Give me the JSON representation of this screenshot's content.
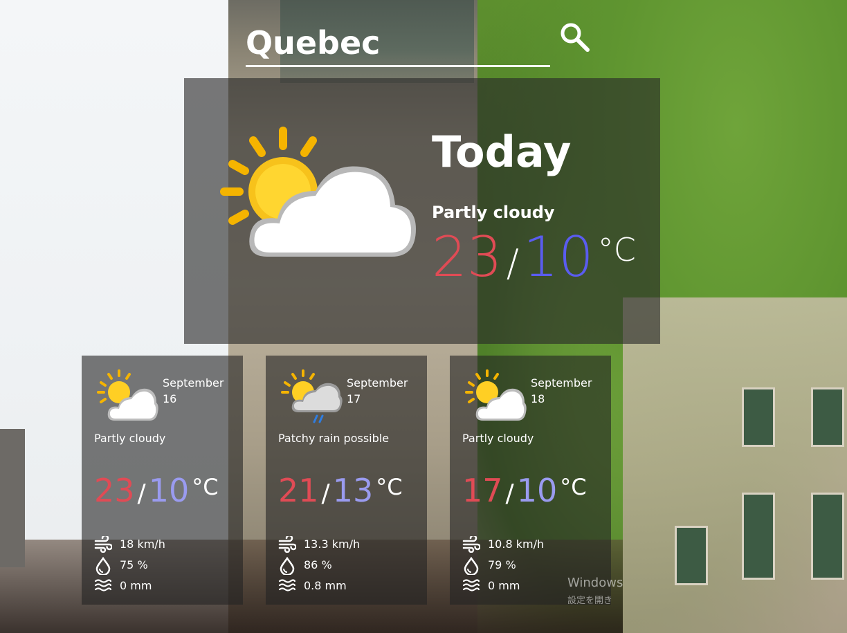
{
  "search": {
    "value": "Quebec",
    "icon": "search-icon"
  },
  "today": {
    "title": "Today",
    "condition": "Partly cloudy",
    "high": "23",
    "separator": "/",
    "low": "10",
    "unit": "°C",
    "icon": "partly-cloudy-icon"
  },
  "forecast": [
    {
      "date": "September 16",
      "condition": "Partly cloudy",
      "high": "23",
      "low": "10",
      "unit": "°C",
      "wind": "18 km/h",
      "humidity": "75 %",
      "precipitation": "0 mm",
      "icon": "partly-cloudy-icon"
    },
    {
      "date": "September 17",
      "condition": "Patchy rain possible",
      "high": "21",
      "low": "13",
      "unit": "°C",
      "wind": "13.3 km/h",
      "humidity": "86 %",
      "precipitation": "0.8 mm",
      "icon": "patchy-rain-icon"
    },
    {
      "date": "September 18",
      "condition": "Partly cloudy",
      "high": "17",
      "low": "10",
      "unit": "°C",
      "wind": "10.8 km/h",
      "humidity": "79 %",
      "precipitation": "0 mm",
      "icon": "partly-cloudy-icon"
    }
  ],
  "separator": "/",
  "os_watermark": {
    "line1": "Windows",
    "line2": "設定を開き"
  },
  "colors": {
    "high_temp": "#e04b55",
    "low_temp_today": "#5a5cf0",
    "low_temp_card": "#9a9bf0",
    "panel_bg": "rgba(40,40,40,0.62)"
  }
}
